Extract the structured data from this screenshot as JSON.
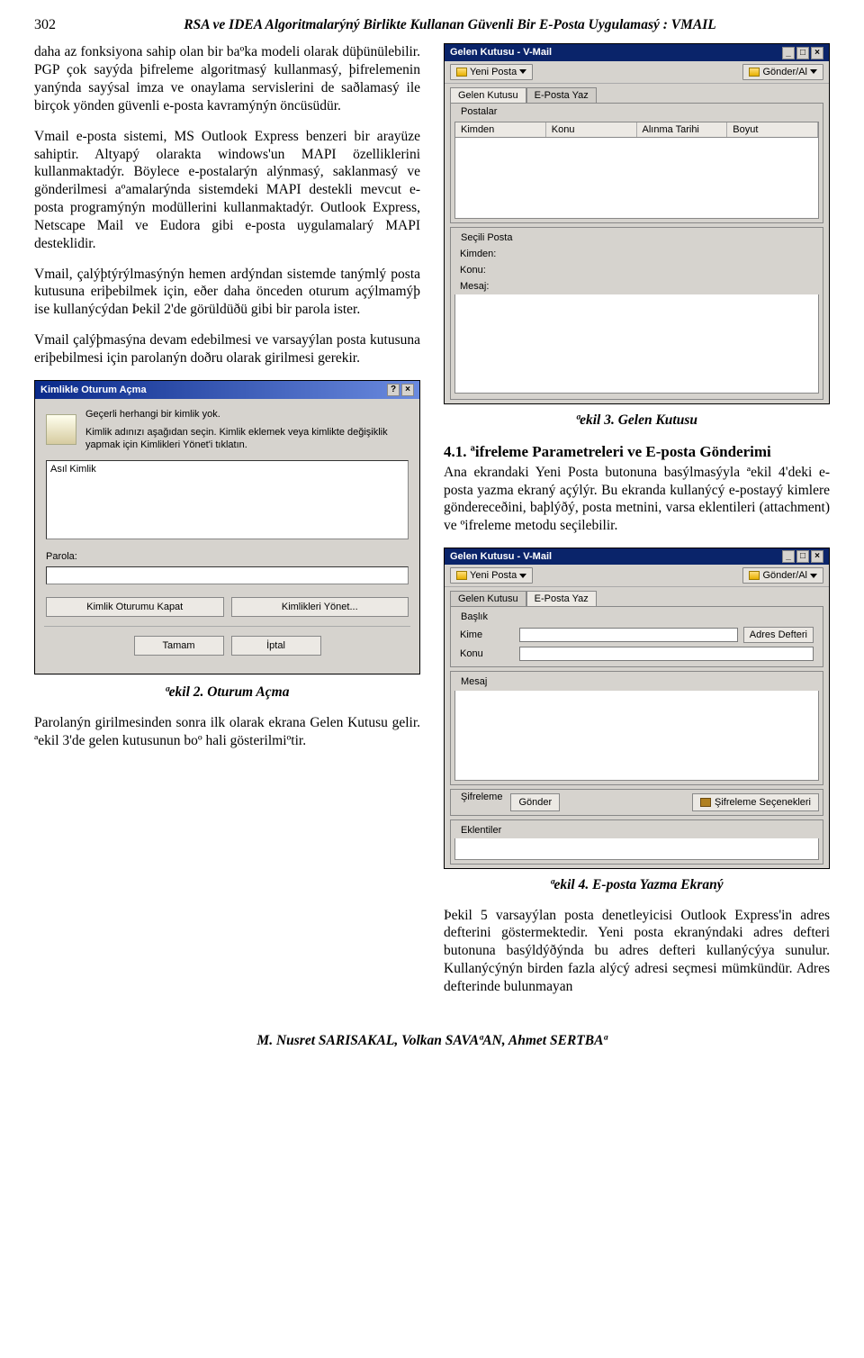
{
  "page_number": "302",
  "running_title": "RSA ve IDEA Algoritmalarýný Birlikte Kullanan Güvenli Bir E-Posta Uygulamasý : VMAIL",
  "left": {
    "p1": "daha az fonksiyona sahip olan bir baºka modeli olarak düþünülebilir. PGP çok sayýda þifreleme algoritmasý kullanmasý, þifrelemenin yanýnda sayýsal imza ve onaylama servislerini de saðlamasý ile birçok yönden güvenli e-posta kavramýnýn öncüsüdür.",
    "p2": "Vmail e-posta sistemi, MS Outlook Express benzeri bir arayüze sahiptir. Altyapý olarakta windows'un MAPI özelliklerini kullanmaktadýr. Böylece e-postalarýn alýnmasý, saklanmasý ve gönderilmesi aºamalarýnda sistemdeki MAPI destekli mevcut e-posta programýnýn modüllerini kullanmaktadýr. Outlook Express, Netscape Mail ve Eudora gibi e-posta uygulamalarý MAPI desteklidir.",
    "p3": "Vmail, çalýþtýrýlmasýnýn hemen ardýndan sistemde tanýmlý posta kutusuna eriþebilmek için, eðer daha önceden oturum açýlmamýþ ise kullanýcýdan Þekil 2'de görüldüðü gibi bir parola ister.",
    "p4": "Vmail çalýþmasýna devam edebilmesi ve varsayýlan posta kutusuna eriþebilmesi için parolanýn doðru olarak girilmesi gerekir.",
    "p5": "Parolanýn girilmesinden sonra ilk olarak ekrana Gelen Kutusu gelir. ªekil 3'de gelen kutusunun boº hali gösterilmiºtir.",
    "caption2": "ªekil 2. Oturum Açma"
  },
  "right": {
    "caption3": "ªekil 3. Gelen Kutusu",
    "h41": "4.1. ªifreleme Parametreleri ve E-posta Gönderimi",
    "p6": "Ana ekrandaki Yeni Posta butonuna basýlmasýyla ªekil 4'deki e-posta yazma ekraný açýlýr. Bu ekranda kullanýcý e-postayý kimlere göndereceðini, baþlýðý, posta metnini, varsa eklentileri (attachment) ve ºifreleme metodu seçilebilir.",
    "caption4": "ªekil 4. E-posta Yazma Ekraný",
    "p7": "Þekil 5 varsayýlan posta denetleyicisi Outlook Express'in adres defterini göstermektedir. Yeni posta ekranýndaki adres defteri butonuna basýldýðýnda bu adres defteri kullanýcýya sunulur. Kullanýcýnýn birden fazla alýcý adresi seçmesi mümkündür. Adres defterinde bulunmayan"
  },
  "login_dialog": {
    "title": "Kimlikle Oturum Açma",
    "msg1": "Geçerli herhangi bir kimlik yok.",
    "msg2": "Kimlik adınızı aşağıdan seçin. Kimlik eklemek veya kimlikte değişiklik yapmak için Kimlikleri Yönet'i tıklatın.",
    "listitem": "Asıl Kimlik",
    "pw_label": "Parola:",
    "btn_close_session": "Kimlik Oturumu Kapat",
    "btn_manage": "Kimlikleri Yönet...",
    "btn_ok": "Tamam",
    "btn_cancel": "İptal"
  },
  "vmail_inbox": {
    "title": "Gelen Kutusu - V-Mail",
    "tool_new": "Yeni Posta",
    "tool_send": "Gönder/Al",
    "tab1": "Gelen Kutusu",
    "tab2": "E-Posta Yaz",
    "cols": [
      "Kimden",
      "Konu",
      "Alınma Tarihi",
      "Boyut"
    ],
    "group_selected": "Seçili Posta",
    "lbl_from": "Kimden:",
    "lbl_subj": "Konu:",
    "lbl_body": "Mesaj:"
  },
  "vmail_compose": {
    "title": "Gelen Kutusu - V-Mail",
    "tool_new": "Yeni Posta",
    "tool_send": "Gönder/Al",
    "tab1": "Gelen Kutusu",
    "tab2": "E-Posta Yaz",
    "grp_header": "Başlık",
    "lbl_to": "Kime",
    "lbl_subj": "Konu",
    "btn_addr": "Adres Defteri",
    "grp_body": "Mesaj",
    "grp_enc": "Şifreleme",
    "btn_send": "Gönder",
    "enc_opts": "Şifreleme Seçenekleri",
    "grp_attach": "Eklentiler"
  },
  "footer_authors": "M. Nusret SARISAKAL, Volkan SAVAªAN, Ahmet SERTBAª"
}
